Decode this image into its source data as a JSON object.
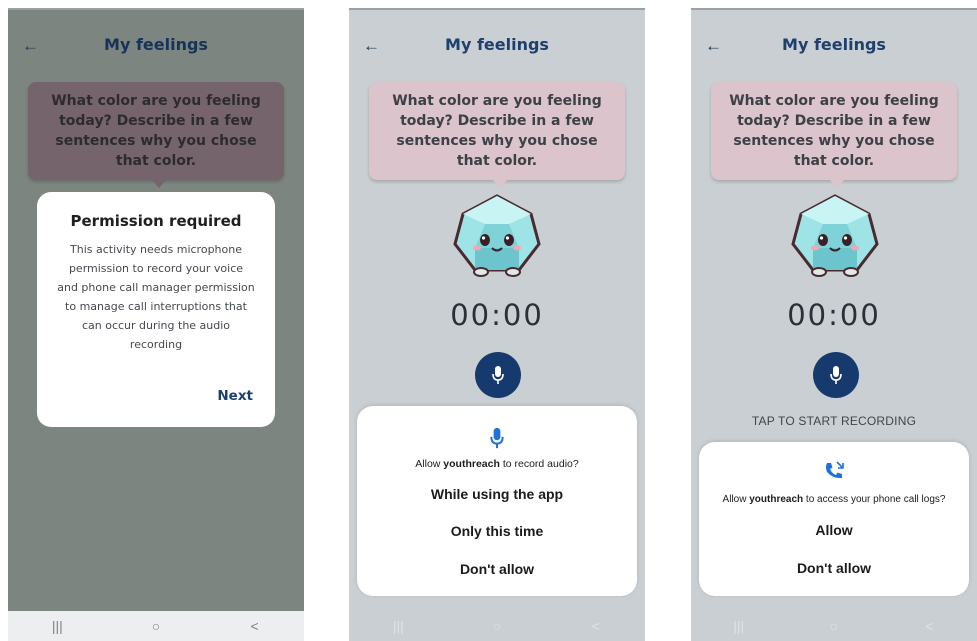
{
  "header": {
    "title": "My feelings",
    "back_icon": "arrow-left-icon"
  },
  "prompt": "What color are you feeling today? Describe in a few sentences why you chose that color.",
  "permission_dialog": {
    "title": "Permission required",
    "body": "This activity needs microphone permission to record your voice and phone call manager permission to manage call interruptions that can occur during the audio recording",
    "next_label": "Next"
  },
  "timer": "00:00",
  "tap_label": "TAP TO START RECORDING",
  "audio_sheet": {
    "icon": "microphone-icon",
    "app_name": "youthreach",
    "prompt_pre": "Allow ",
    "prompt_post": " to record audio?",
    "options": [
      "While using the app",
      "Only this time",
      "Don't allow"
    ]
  },
  "calllog_sheet": {
    "icon": "phone-call-log-icon",
    "app_name": "youthreach",
    "prompt_pre": "Allow ",
    "prompt_post": " to access your phone call logs?",
    "options": [
      "Allow",
      "Don't allow"
    ]
  },
  "navbar": {
    "recent": "|||",
    "home": "○",
    "back": "<"
  },
  "colors": {
    "accent": "#173a6e",
    "bubble": "#dbc4cb",
    "background": "#c9cfd2",
    "dim_overlay": "#7d8580"
  }
}
